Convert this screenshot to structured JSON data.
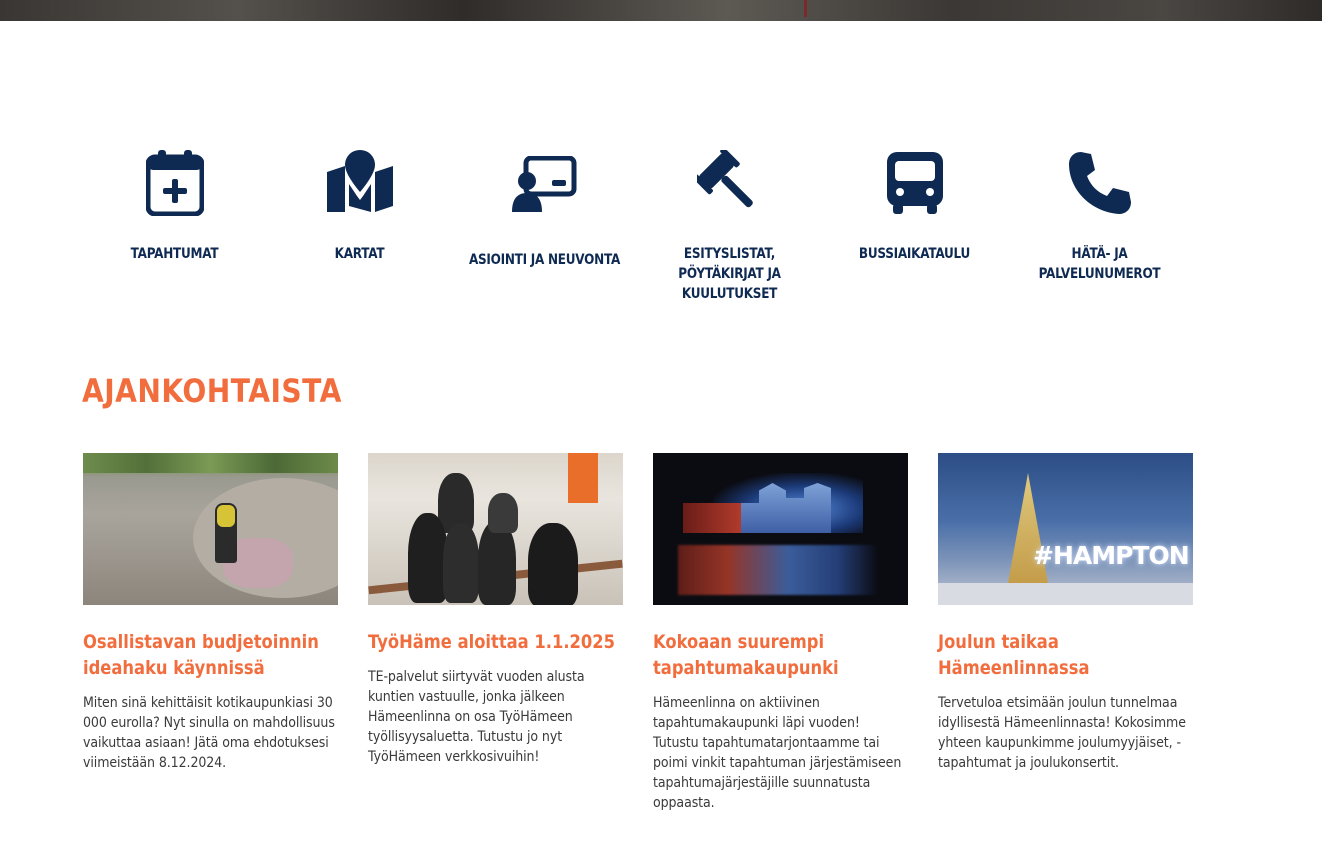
{
  "quicklinks": [
    {
      "label": "TAPAHTUMAT",
      "icon": "calendar-plus-icon"
    },
    {
      "label": "KARTAT",
      "icon": "map-pin-icon"
    },
    {
      "label": "ASIOINTI JA NEUVONTA",
      "icon": "presentation-user-icon"
    },
    {
      "label": "ESITYSLISTAT, PÖYTÄKIRJAT JA KUULUTUKSET",
      "icon": "gavel-icon"
    },
    {
      "label": "BUSSIAIKATAULU",
      "icon": "bus-icon"
    },
    {
      "label": "HÄTÄ- JA PALVELUNUMEROT",
      "icon": "phone-icon"
    }
  ],
  "news": {
    "heading": "AJANKOHTAISTA",
    "items": [
      {
        "title": "Osallistavan budjetoinnin ideahaku käynnissä",
        "description": "Miten sinä kehittäisit kotikaupunkiasi 30 000 eurolla? Nyt sinulla on mahdollisuus vaikuttaa asiaan! Jätä oma ehdotuksesi viimeistään 8.12.2024.",
        "image": "skatepark-photo"
      },
      {
        "title": "TyöHäme aloittaa 1.1.2025",
        "description": "TE-palvelut siirtyvät vuoden alusta kuntien vastuulle, jonka jälkeen Hämeenlinna on osa TyöHämeen työllisyysaluetta. Tutustu jo nyt TyöHämeen verkkosivuihin!",
        "image": "group-photo"
      },
      {
        "title": "Kokoaan suurempi tapahtumakaupunki",
        "description": "Hämeenlinna on aktiivinen tapahtumakaupunki läpi vuoden! Tutustu tapahtumatarjontaamme tai poimi vinkit tapahtuman järjestämiseen tapahtumajärjestäjille suunnatusta oppaasta.",
        "image": "castle-night-photo"
      },
      {
        "title": "Joulun taikaa Hämeenlinnassa",
        "description": "Tervetuloa etsimään joulun tunnelmaa idyllisestä Hämeenlinnasta! Kokosimme yhteen kaupunkimme joulumyyjäiset, -tapahtumat ja joulukonsertit.",
        "image": "christmas-tree-photo",
        "image_text": "#HAMPTON"
      }
    ]
  },
  "colors": {
    "navy": "#0f2a52",
    "orange": "#f26d3d",
    "text": "#3a3a3a"
  }
}
